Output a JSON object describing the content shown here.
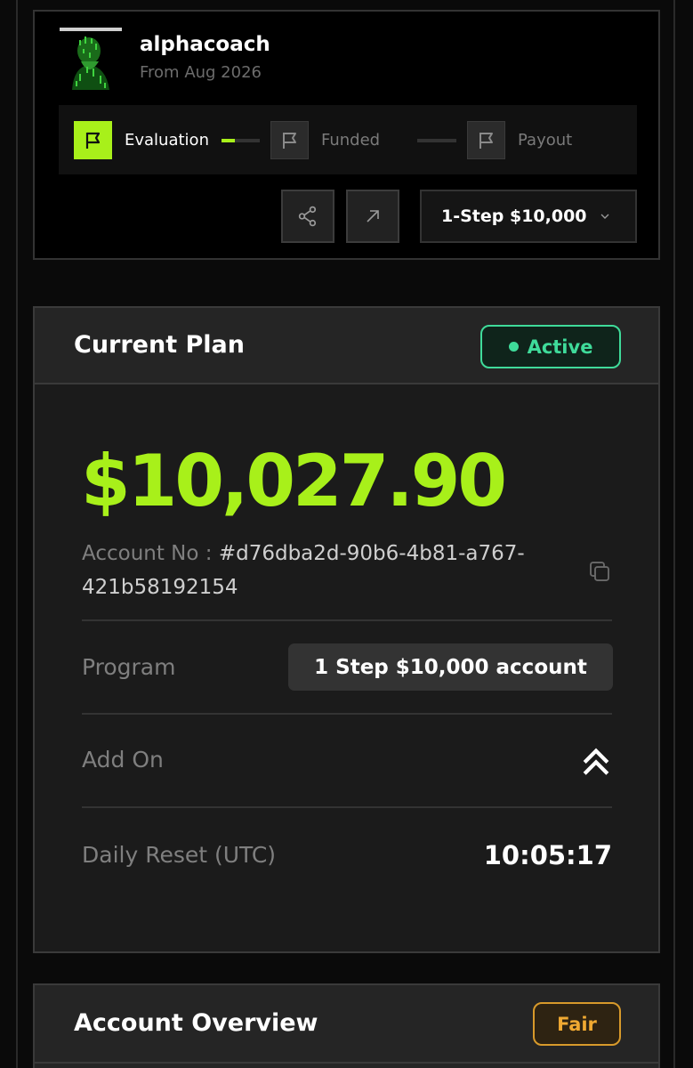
{
  "profile": {
    "username": "alphacoach",
    "member_since": "From Aug 2026"
  },
  "stepper": {
    "steps": [
      {
        "label": "Evaluation",
        "icon": "flag-icon",
        "active": true
      },
      {
        "label": "Funded",
        "icon": "flag-icon",
        "active": false
      },
      {
        "label": "Payout",
        "icon": "flag-icon",
        "active": false
      }
    ],
    "evaluation_progress": 0.35
  },
  "actions": {
    "share_icon": "share-icon",
    "open_icon": "arrow-up-right-icon",
    "plan_select_value": "1-Step $10,000"
  },
  "current_plan": {
    "title": "Current Plan",
    "status": "Active",
    "balance": "$10,027.90",
    "account_label": "Account No : ",
    "account_number": "#d76dba2d-90b6-4b81-a767-421b58192154",
    "program_label": "Program",
    "program_value": "1 Step $10,000 account",
    "addon_label": "Add On",
    "addon_icon": "double-chevron-up-icon",
    "daily_reset_label": "Daily Reset (UTC)",
    "daily_reset_value": "10:05:17"
  },
  "account_overview": {
    "title": "Account Overview",
    "badge": "Fair"
  },
  "colors": {
    "accent": "#a8f01a",
    "active": "#3fdb9a",
    "fair": "#f0a932",
    "background": "#0a0a0a"
  }
}
